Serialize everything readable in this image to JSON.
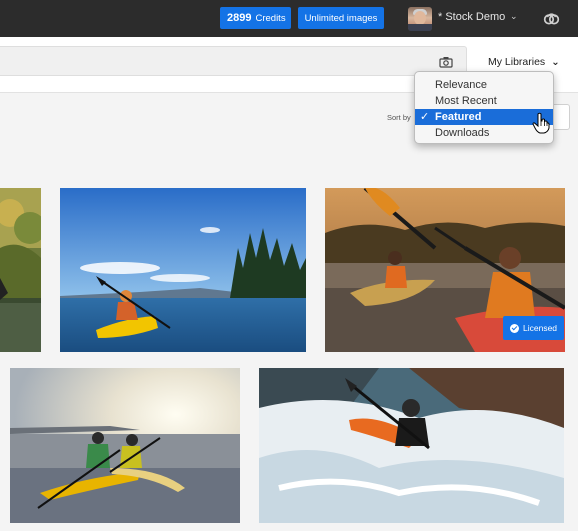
{
  "header": {
    "credits_count": "2899",
    "credits_label": "Credits",
    "unlimited_label": "Unlimited images",
    "user_name": "* Stock Demo"
  },
  "search": {
    "placeholder": "",
    "library_label": "My Libraries"
  },
  "sort": {
    "label": "Sort by",
    "options": [
      "Relevance",
      "Most Recent",
      "Featured",
      "Downloads"
    ],
    "selected": "Featured"
  },
  "badges": {
    "licensed_label": "Licensed"
  },
  "colors": {
    "accent": "#1473e6",
    "topbar": "#2c2c2c",
    "selected_menu": "#1a6dd9"
  },
  "icons": {
    "camera": "camera-icon",
    "creative_cloud": "creative-cloud-icon",
    "chevron": "chevron-down-icon",
    "check": "checkmark-icon",
    "cursor": "hand-pointer-icon"
  }
}
